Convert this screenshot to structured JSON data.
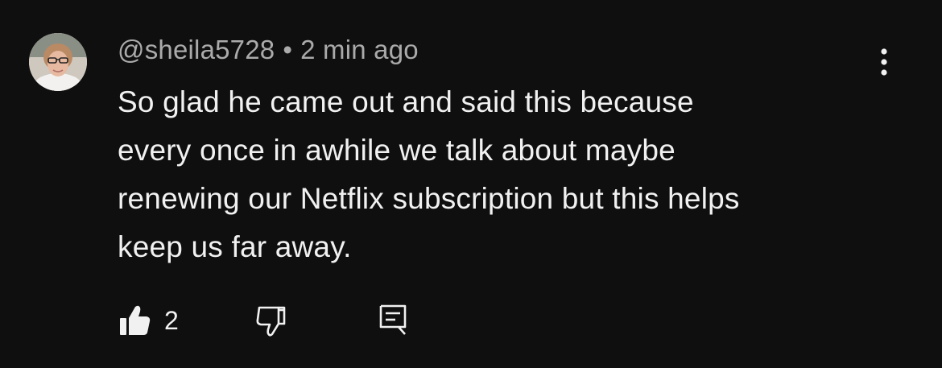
{
  "comment": {
    "author": "@sheila5728",
    "separator": "•",
    "timestamp": "2 min ago",
    "text_lines": [
      "So glad he came out and said this because",
      "every once in awhile we talk about maybe",
      "renewing our Netflix subscription but this helps",
      "keep us far away."
    ],
    "like_count": "2",
    "icons": {
      "like": "thumbs-up-filled-icon",
      "dislike": "thumbs-down-outline-icon",
      "reply": "comment-reply-icon",
      "more": "more-vertical-icon"
    }
  },
  "colors": {
    "background": "#0f0f0f",
    "primary_text": "#f1f1f1",
    "secondary_text": "#aaaaaa"
  }
}
